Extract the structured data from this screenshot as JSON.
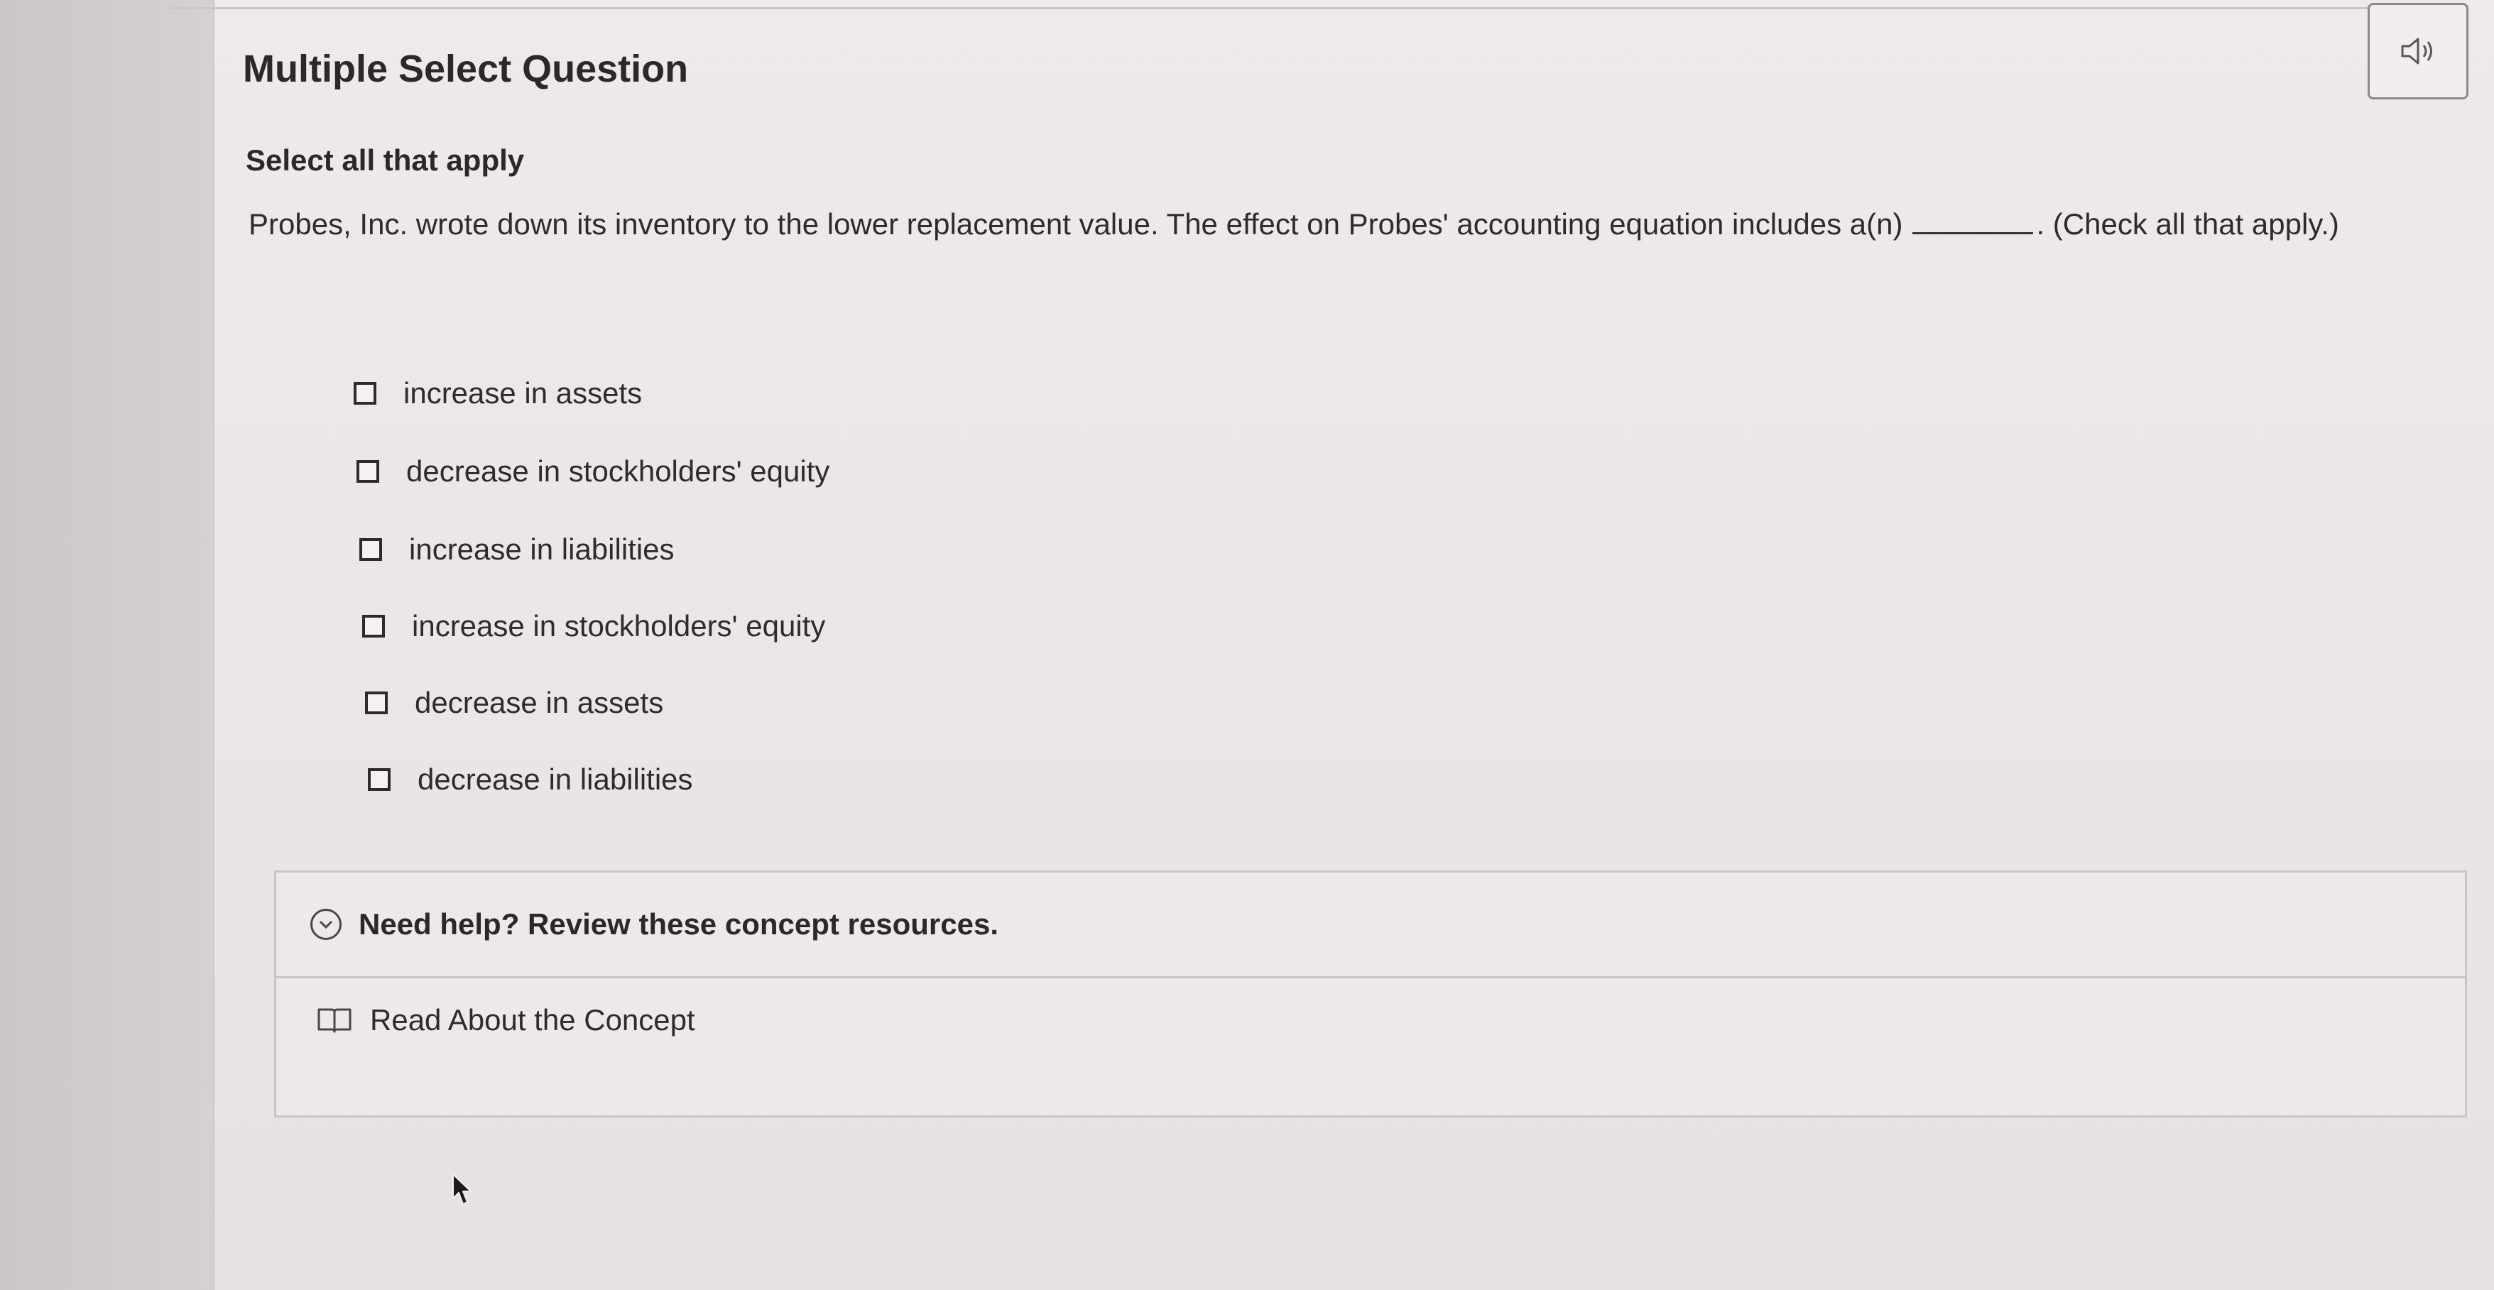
{
  "question": {
    "type_label": "Multiple Select Question",
    "instruction": "Select all that apply",
    "prompt_before_blank": "Probes, Inc. wrote down its inventory to the lower replacement value. The effect on Probes' accounting equation includes a(n)",
    "prompt_after_blank": ". (Check all that apply.)"
  },
  "options": [
    {
      "label": "increase in assets",
      "checked": false
    },
    {
      "label": "decrease in stockholders' equity",
      "checked": false
    },
    {
      "label": "increase in liabilities",
      "checked": false
    },
    {
      "label": "increase in stockholders' equity",
      "checked": false
    },
    {
      "label": "decrease in assets",
      "checked": false
    },
    {
      "label": "decrease in liabilities",
      "checked": false
    }
  ],
  "help": {
    "title": "Need help? Review these concept resources.",
    "link_label": "Read About the Concept"
  },
  "icons": {
    "audio": "speaker-icon",
    "help_toggle": "chevron-down-circle-icon",
    "resource": "book-icon",
    "pointer": "mouse-cursor-icon"
  }
}
